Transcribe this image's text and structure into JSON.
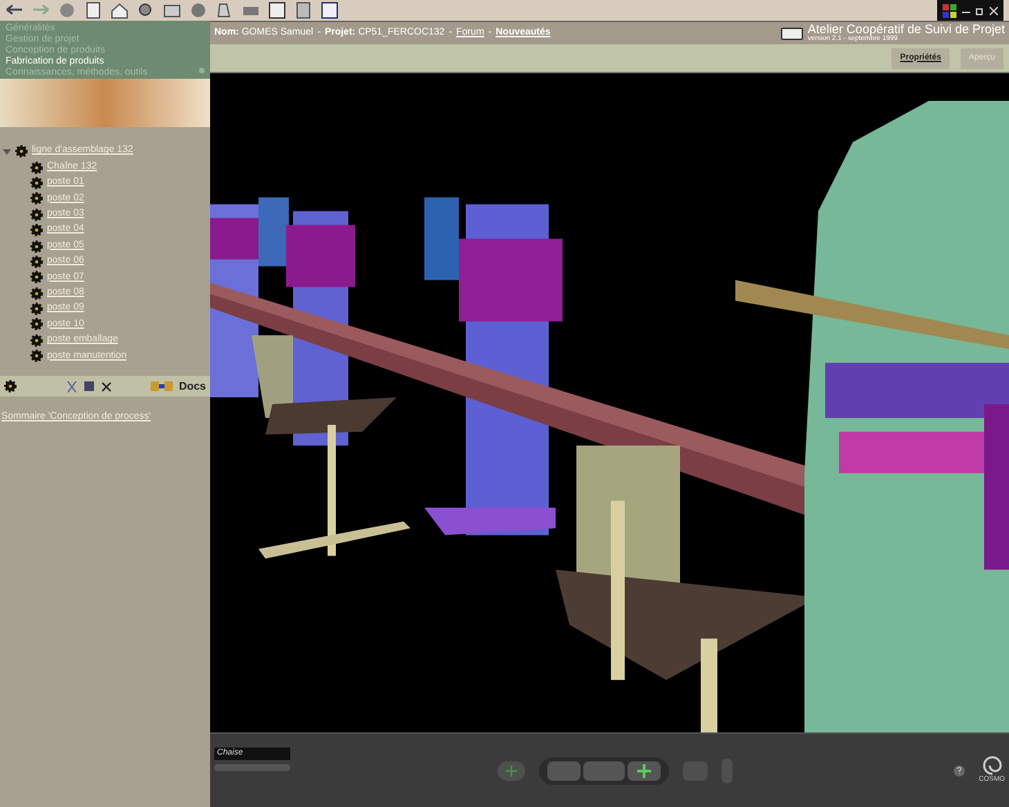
{
  "nav": {
    "items": [
      {
        "label": "Généralités",
        "selected": false
      },
      {
        "label": "Gestion de projet",
        "selected": false
      },
      {
        "label": "Conception de produits",
        "selected": false
      },
      {
        "label": "Fabrication de produits",
        "selected": true
      },
      {
        "label": "Connaissances, méthodes, outils",
        "selected": false
      }
    ]
  },
  "header": {
    "separators": [
      "-",
      "-",
      "-"
    ],
    "name_label": "Nom:",
    "name": "GOMES Samuel",
    "project_label": "Projet:",
    "project": "CP51_FERCOC132",
    "links": [
      "Forum",
      "Nouveautés"
    ],
    "title": "Atelier Coopératif de Suivi de Projet",
    "version": "version 2.1 - septembre 1999"
  },
  "view_tabs": [
    {
      "label": "Propriétés",
      "selected": true
    },
    {
      "label": "Aperçu",
      "selected": false
    }
  ],
  "tree": {
    "label": "ligne d'assemblage 132",
    "expanded": true,
    "children": [
      {
        "label": "Chaîne 132"
      },
      {
        "label": "poste 01"
      },
      {
        "label": "poste 02"
      },
      {
        "label": "poste 03"
      },
      {
        "label": "poste 04"
      },
      {
        "label": "poste 05"
      },
      {
        "label": "poste 06"
      },
      {
        "label": "poste 07"
      },
      {
        "label": "poste 08"
      },
      {
        "label": "poste 09"
      },
      {
        "label": "poste 10"
      },
      {
        "label": "poste emballage"
      },
      {
        "label": "poste manutention"
      }
    ]
  },
  "tree_toolbar": {
    "docs": "Docs"
  },
  "summary_link": "Sommaire 'Conception de process'",
  "viewer": {
    "viewpoint": "Chaise",
    "logo": "COSMO"
  }
}
